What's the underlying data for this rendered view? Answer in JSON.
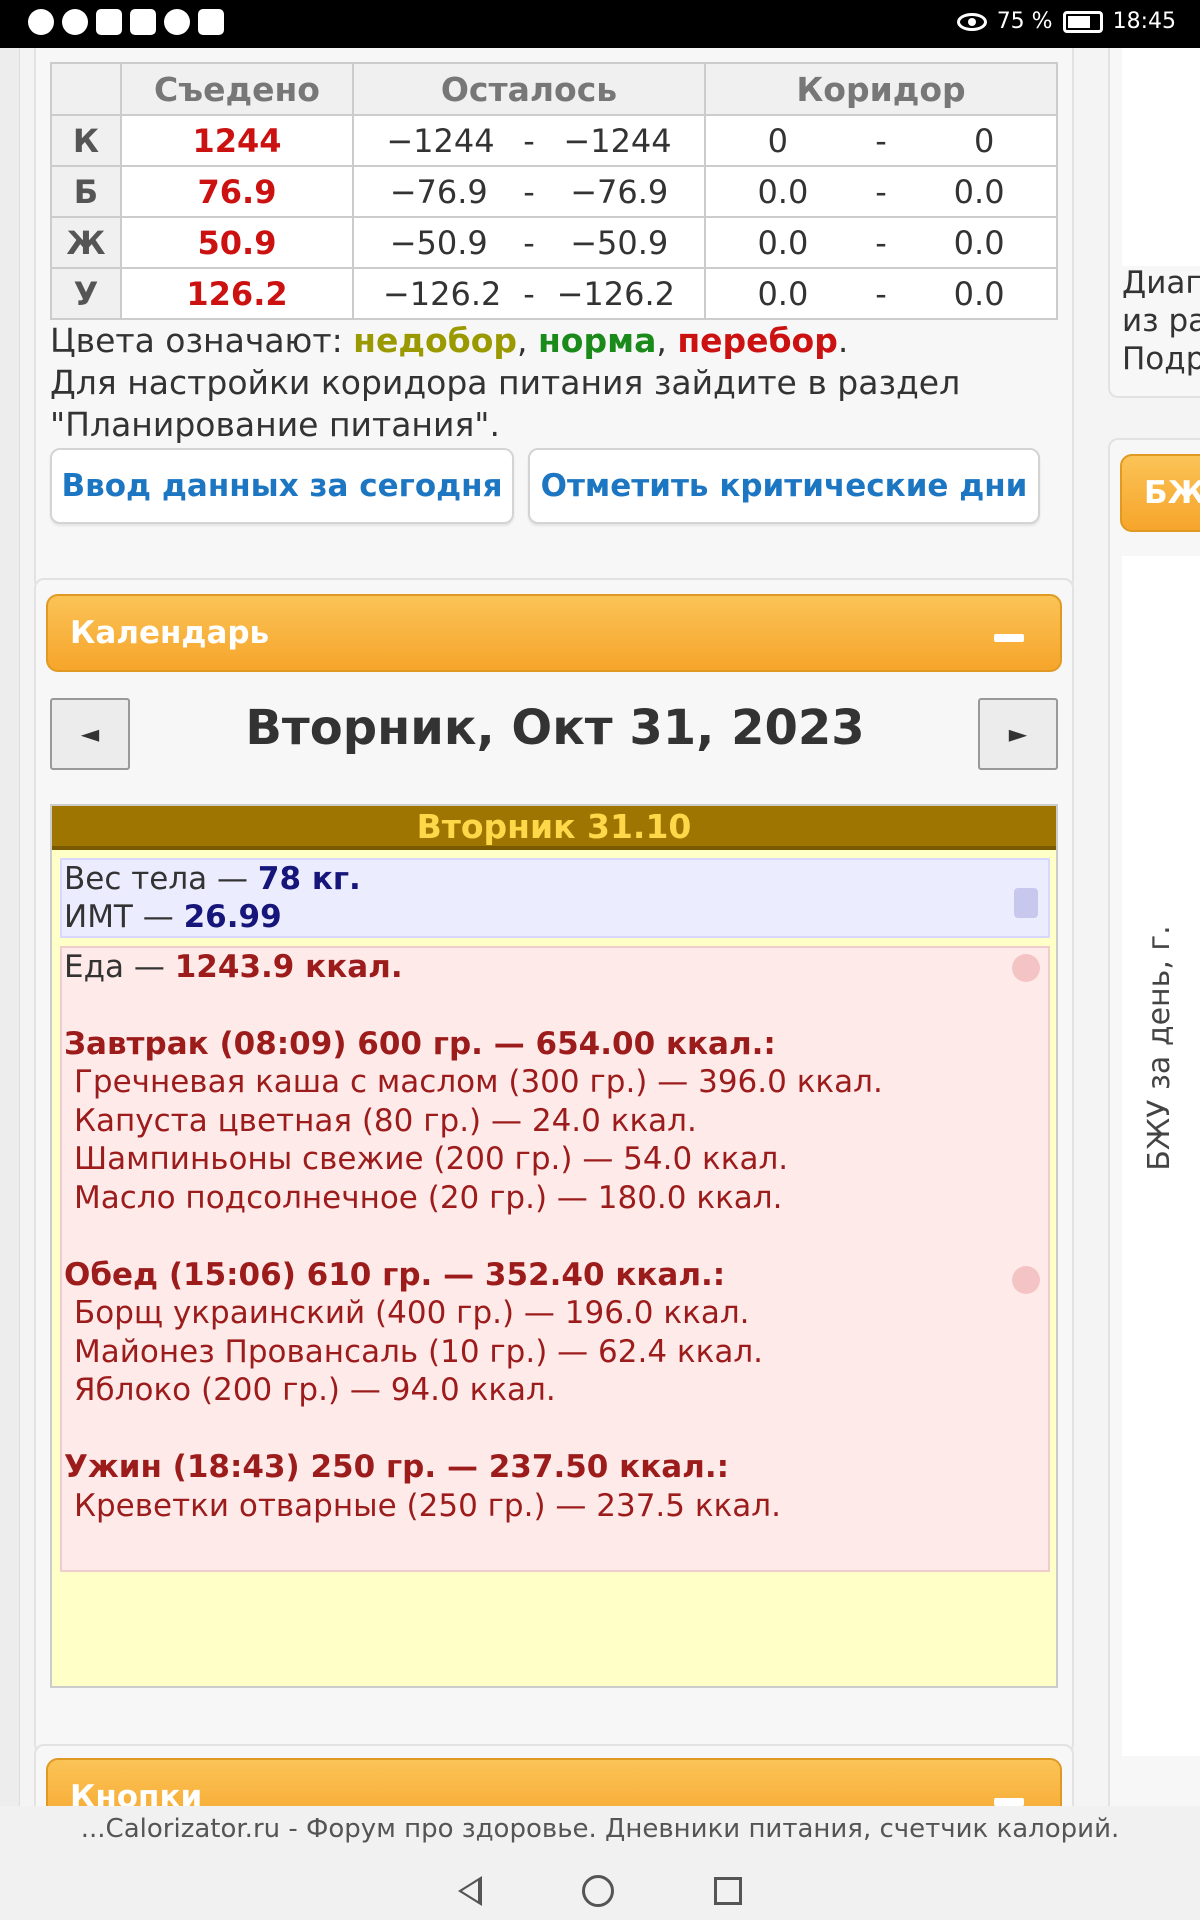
{
  "status": {
    "battery": "75 %",
    "time": "18:45"
  },
  "table": {
    "headers": [
      "",
      "Съедено",
      "Осталось",
      "Коридор"
    ],
    "separator": "-",
    "rows": [
      {
        "label": "К",
        "eaten": "1244",
        "left_from": "−1244",
        "left_to": "−1244",
        "corr_from": "0",
        "corr_to": "0"
      },
      {
        "label": "Б",
        "eaten": "76.9",
        "left_from": "−76.9",
        "left_to": "−76.9",
        "corr_from": "0.0",
        "corr_to": "0.0"
      },
      {
        "label": "Ж",
        "eaten": "50.9",
        "left_from": "−50.9",
        "left_to": "−50.9",
        "corr_from": "0.0",
        "corr_to": "0.0"
      },
      {
        "label": "У",
        "eaten": "126.2",
        "left_from": "−126.2",
        "left_to": "−126.2",
        "corr_from": "0.0",
        "corr_to": "0.0"
      }
    ]
  },
  "legend": {
    "prefix": "Цвета означают: ",
    "under": "недобор",
    "comma1": ", ",
    "norm": "норма",
    "comma2": ", ",
    "over": "перебор",
    "dot": ".",
    "note": "Для настройки коридора питания зайдите в раздел \"Планирование питания\"."
  },
  "buttons": {
    "enter_today": "Ввод данных за сегодня",
    "critical_days": "Отметить критические дни"
  },
  "calendar": {
    "header": "Календарь",
    "prev": "◄",
    "next": "►",
    "title": "Вторник, Окт 31, 2023",
    "day_header": "Вторник 31.10",
    "weight_label": "Вес тела — ",
    "weight_value": "78 кг.",
    "bmi_label": "ИМТ — ",
    "bmi_value": "26.99",
    "food_label": "Еда — ",
    "food_value": "1243.9 ккал.",
    "meals": [
      {
        "title": "Завтрак (08:09) 600 гр. — 654.00 ккал.:",
        "items": [
          "Гречневая каша с маслом (300 гр.) — 396.0 ккал.",
          "Капуста цветная (80 гр.) — 24.0 ккал.",
          "Шампиньоны свежие (200 гр.) — 54.0 ккал.",
          "Масло подсолнечное (20 гр.) — 180.0 ккал."
        ]
      },
      {
        "title": "Обед (15:06) 610 гр. — 352.40 ккал.:",
        "items": [
          "Борщ украинский (400 гр.) — 196.0 ккал.",
          "Майонез Провансаль (10 гр.) — 62.4 ккал.",
          "Яблоко (200 гр.) — 94.0 ккал."
        ]
      },
      {
        "title": "Ужин (18:43) 250 гр. — 237.50 ккал.:",
        "items": [
          "Креветки отварные (250 гр.) — 237.5 ккал."
        ]
      }
    ]
  },
  "buttons_panel": {
    "header": "Кнопки"
  },
  "right_col": {
    "line1": "Диаг",
    "line2": "из ра",
    "line3": "Подр",
    "tab": "БЖ",
    "vertical": "БЖУ за день, г."
  },
  "footer": {
    "text": "...Calorizator.ru - Форум про здоровье. Дневники питания, счетчик калорий."
  }
}
